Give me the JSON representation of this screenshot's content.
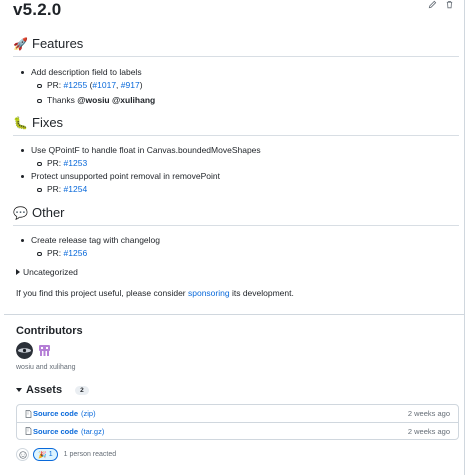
{
  "release": {
    "title": "v5.2.0"
  },
  "sections": {
    "features": {
      "emoji": "🚀",
      "heading": "Features",
      "item1": "Add description field to labels",
      "item1_pr_label": "PR:",
      "item1_pr_link": "#1255",
      "item1_pr_open": "(",
      "item1_pr_ref1": "#1017",
      "item1_pr_sep": ",",
      "item1_pr_ref2": "#917",
      "item1_pr_close": ")",
      "item1_thanks_label": "Thanks",
      "item1_thanks_users": "@wosiu @xulihang"
    },
    "fixes": {
      "emoji": "🐛",
      "heading": "Fixes",
      "item1": "Use QPointF to handle float in Canvas.boundedMoveShapes",
      "item1_pr_label": "PR:",
      "item1_pr_link": "#1253",
      "item2": "Protect unsupported point removal in removePoint",
      "item2_pr_label": "PR:",
      "item2_pr_link": "#1254"
    },
    "other": {
      "emoji": "💬",
      "heading": "Other",
      "item1": "Create release tag with changelog",
      "item1_pr_label": "PR:",
      "item1_pr_link": "#1256"
    }
  },
  "uncategorized": {
    "label": "Uncategorized"
  },
  "sponsor": {
    "before": "If you find this project useful, please consider",
    "link": "sponsoring",
    "after": "its development."
  },
  "contributors": {
    "heading": "Contributors",
    "names": "wosiu and xulihang"
  },
  "assets": {
    "heading": "Assets",
    "count": "2",
    "rows": [
      {
        "name": "Source code",
        "ext": "(zip)",
        "time": "2 weeks ago"
      },
      {
        "name": "Source code",
        "ext": "(tar.gz)",
        "time": "2 weeks ago"
      }
    ]
  },
  "reactions": {
    "emoji": "🎉",
    "count": "1",
    "text": "1 person reacted"
  },
  "colors": {
    "link": "#0969da",
    "border": "#d0d7de",
    "muted": "#656d76"
  }
}
